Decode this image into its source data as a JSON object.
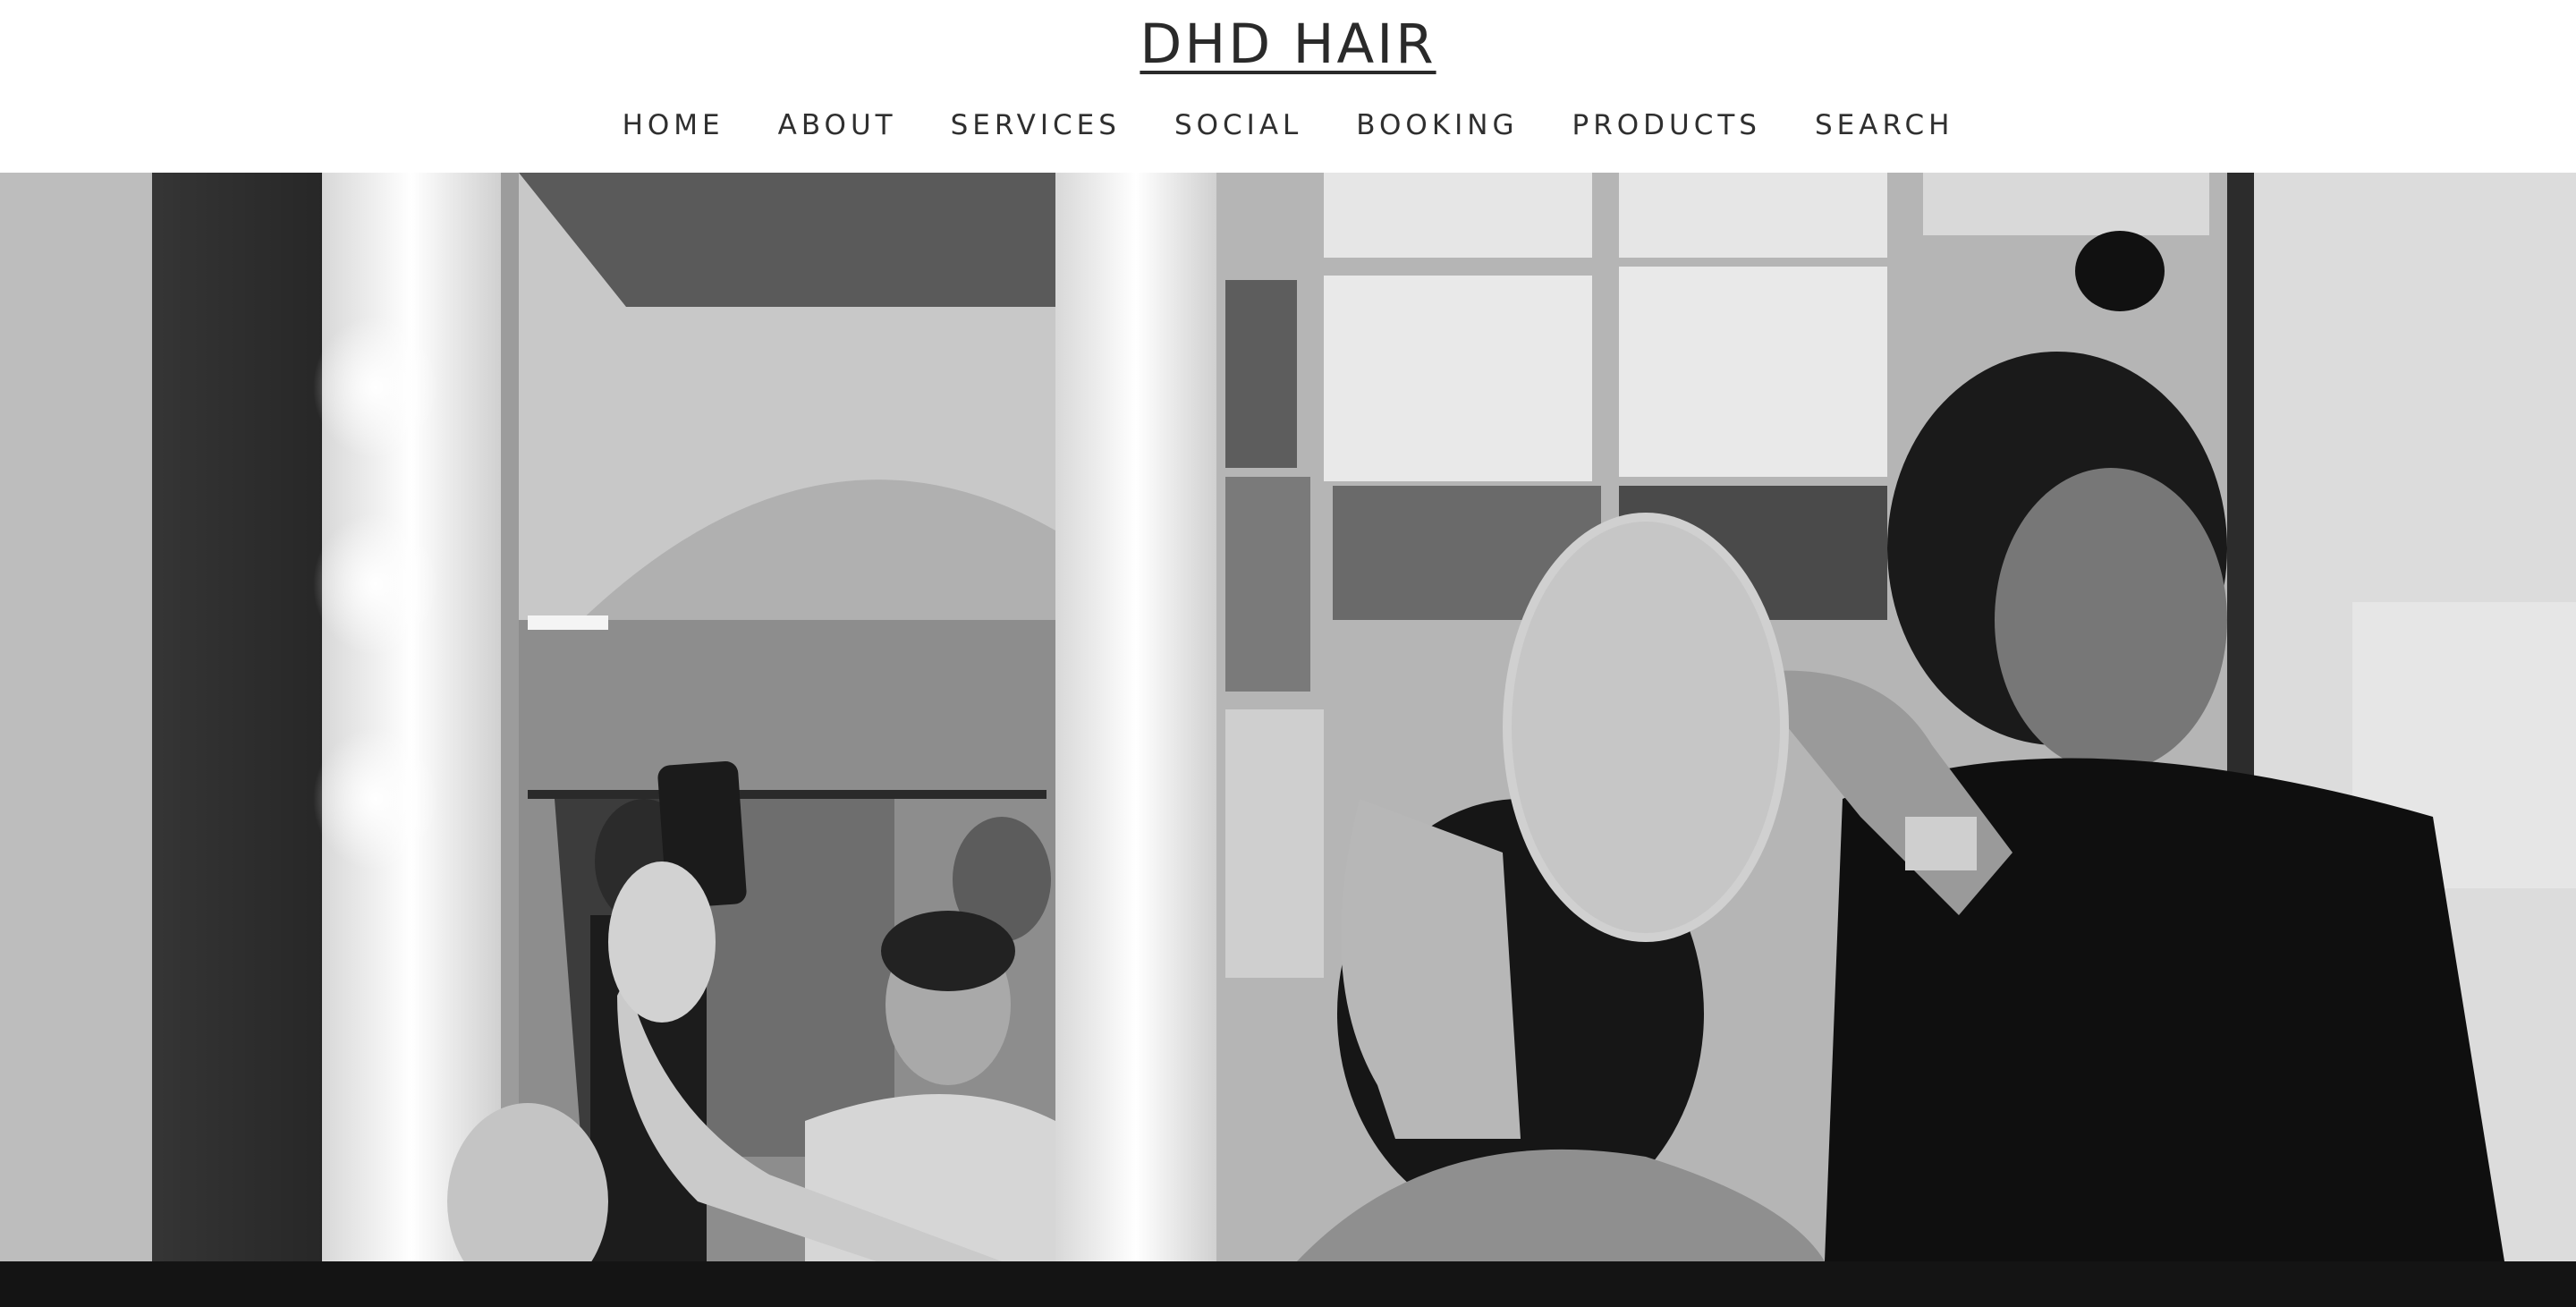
{
  "site": {
    "title": "DHD HAIR"
  },
  "nav": {
    "items": [
      {
        "label": "HOME"
      },
      {
        "label": "ABOUT"
      },
      {
        "label": "SERVICES"
      },
      {
        "label": "SOCIAL"
      },
      {
        "label": "BOOKING"
      },
      {
        "label": "PRODUCTS"
      },
      {
        "label": "SEARCH"
      }
    ]
  },
  "hero": {
    "image": "black-and-white photo: stylist arranging baby's breath flowers in a bride's hair backstage, bride holding phone, mirror reflection behind",
    "tone": "grayscale"
  },
  "colors": {
    "header_bg": "#ffffff",
    "text": "#2a2a2a",
    "footer_bar": "#141414"
  }
}
